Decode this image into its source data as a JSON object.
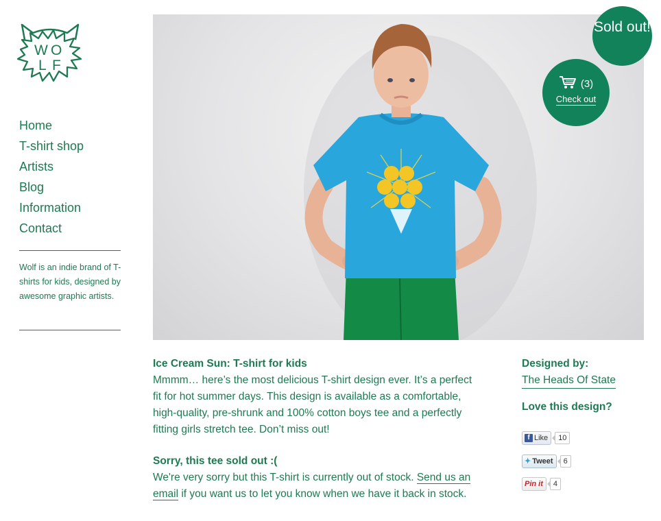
{
  "brand": {
    "logo_text": "WOLF"
  },
  "nav": {
    "items": [
      {
        "label": "Home"
      },
      {
        "label": "T-shirt shop"
      },
      {
        "label": "Artists"
      },
      {
        "label": "Blog"
      },
      {
        "label": "Information"
      },
      {
        "label": "Contact"
      }
    ]
  },
  "sidebar": {
    "blurb": "Wolf is an indie brand of T-shirts for kids, designed by awesome graphic artists."
  },
  "badges": {
    "sold_out": "Sold out!",
    "cart_count": "(3)",
    "checkout": "Check out",
    "icon": "cart-icon"
  },
  "product": {
    "title": "Ice Cream Sun: T-shirt for kids",
    "description": "Mmmm… here’s the most delicious T-shirt design ever. It’s a perfect fit for hot summer days. This design is available as a comfortable, high-quality, pre-shrunk and 100% cotton boys tee and a perfectly fitting girls stretch tee. Don’t miss out!",
    "sold_heading": "Sorry, this tee sold out :(",
    "sold_text_before": "We're very sorry but this T-shirt is currently out of stock. ",
    "sold_link": "Send us an email",
    "sold_text_after": " if you want us to let you know when we have it back in stock."
  },
  "designer": {
    "heading": "Designed by:",
    "name": "The Heads Of State",
    "love_heading": "Love this design?"
  },
  "social": {
    "like": {
      "label": "Like",
      "count": "10"
    },
    "tweet": {
      "label": "Tweet",
      "count": "6"
    },
    "pin": {
      "label": "Pin it",
      "count": "4"
    }
  },
  "colors": {
    "brand_green": "#1e7a52",
    "badge_green": "#12825a",
    "shirt_blue": "#29a6dc",
    "pants_green": "#138a45"
  }
}
